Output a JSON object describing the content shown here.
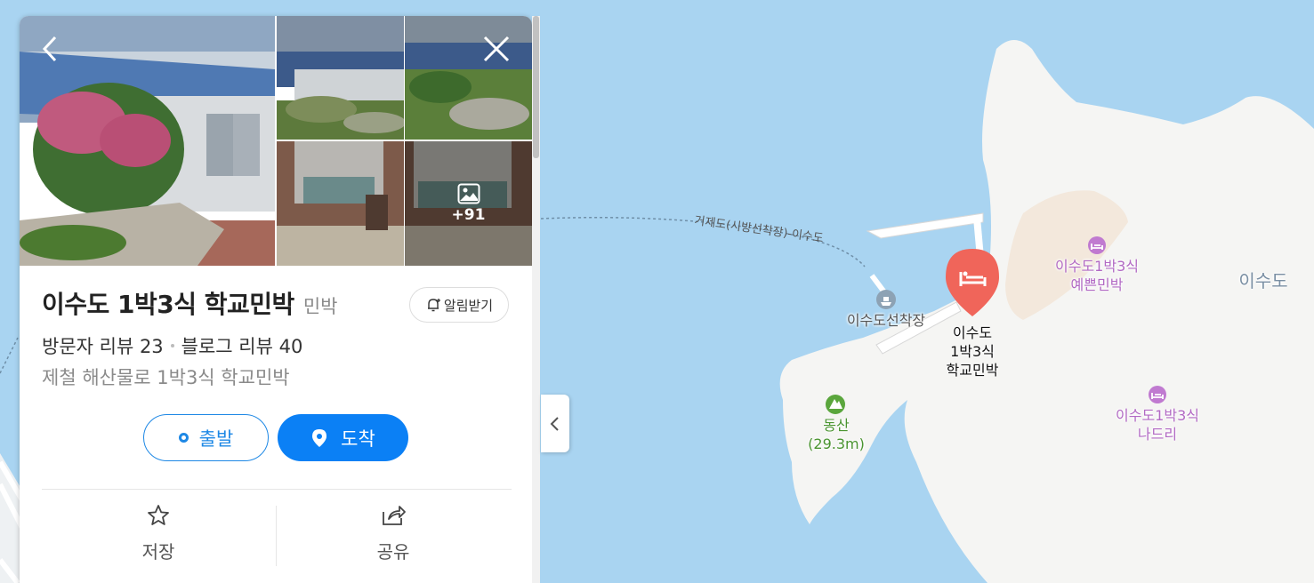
{
  "place": {
    "title": "이수도 1박3식 학교민박",
    "category": "민박",
    "alarm_label": "알림받기",
    "visitor_reviews": "방문자 리뷰 23",
    "blog_reviews": "블로그 리뷰 40",
    "subtitle": "제철 해산물로 1박3식 학교민박",
    "more_photos": "+91"
  },
  "buttons": {
    "start": "출발",
    "arrive": "도착",
    "save": "저장",
    "share": "공유"
  },
  "map": {
    "ferry_route": "거제도(시방선착장)-이수도",
    "pier": "이수도선착장",
    "selected_marker": [
      "이수도",
      "1박3식",
      "학교민박"
    ],
    "poi_1": [
      "이수도1박3식",
      "예쁜민박"
    ],
    "poi_2": [
      "이수도1박3식",
      "나드리"
    ],
    "mountain_name": "동산",
    "mountain_height": "(29.3m)",
    "island_name": "이수도"
  },
  "colors": {
    "accent": "#0b80f5",
    "sea": "#a9d4f1",
    "land": "#f5f5f3",
    "marker": "#f0655a",
    "poi": "#c07ad0",
    "mountain": "#5aa63c"
  },
  "icons": {
    "back": "chevron-left-icon",
    "close": "close-icon",
    "gallery": "image-icon",
    "alarm": "bell-plus-icon",
    "start": "ring-icon",
    "arrive": "location-pin-icon",
    "save": "star-icon",
    "share": "share-icon",
    "collapse": "chevron-left-icon",
    "pier": "ferry-icon",
    "lodging": "bed-icon",
    "mountain": "mountain-icon"
  }
}
